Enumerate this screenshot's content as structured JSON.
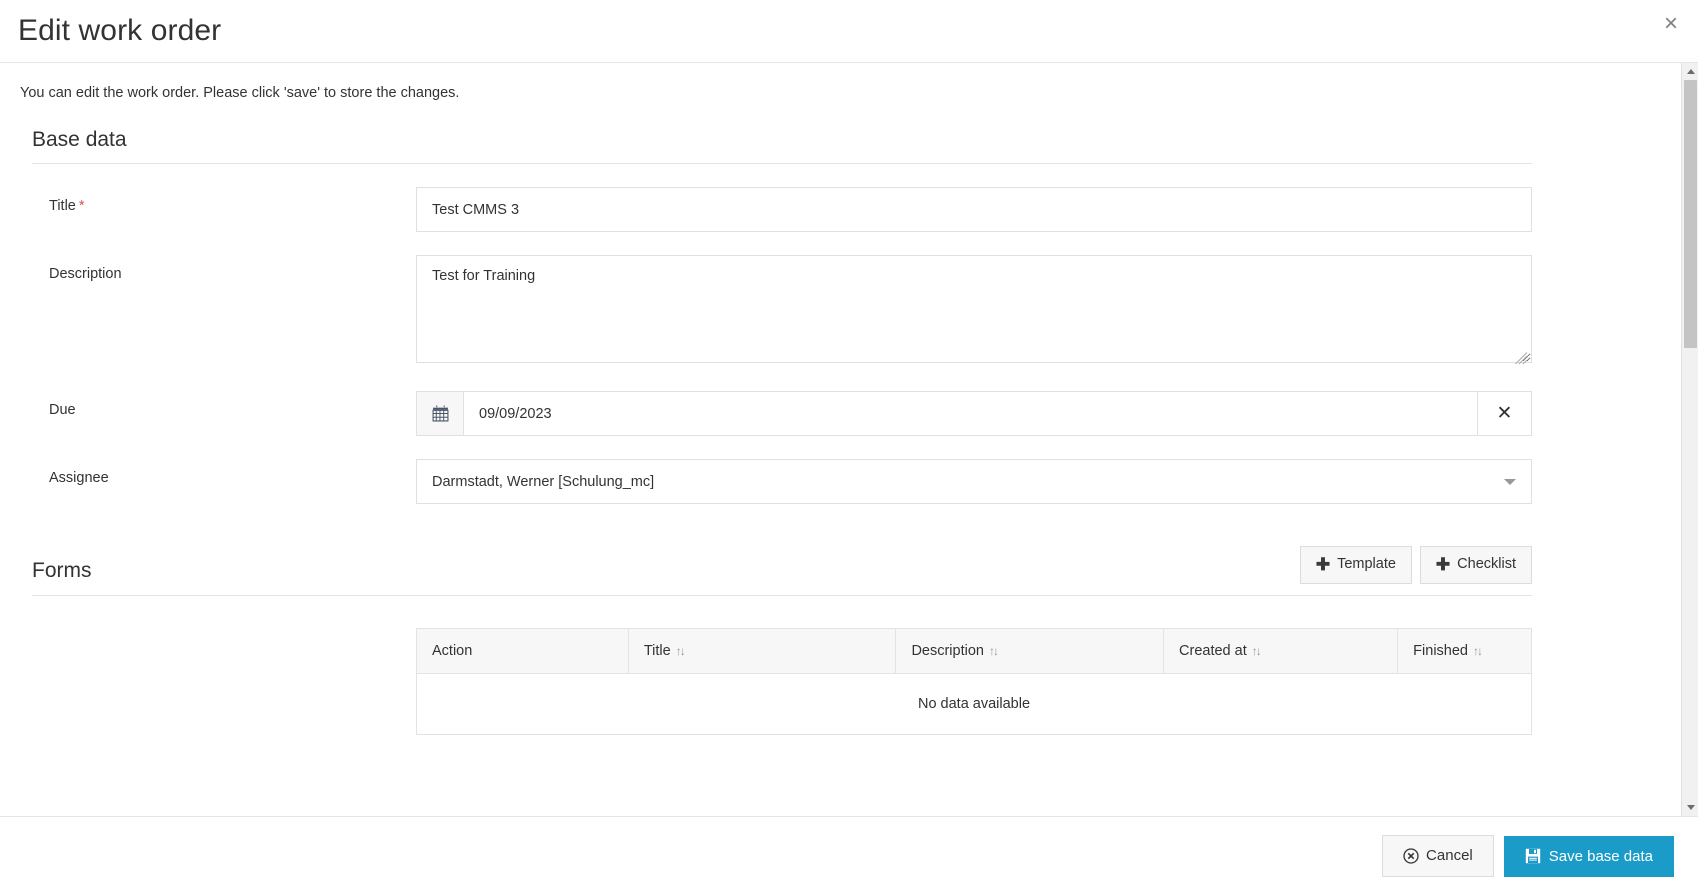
{
  "dialog": {
    "title": "Edit work order",
    "close_label": "×",
    "intro": "You can edit the work order. Please click 'save' to store the changes."
  },
  "base_data": {
    "section_title": "Base data",
    "fields": {
      "title": {
        "label": "Title",
        "required_marker": "*",
        "value": "Test CMMS 3",
        "placeholder": ""
      },
      "description": {
        "label": "Description",
        "value": "Test for Training",
        "placeholder": ""
      },
      "due": {
        "label": "Due",
        "value": "09/09/2023",
        "placeholder": "",
        "calendar_icon": "calendar-icon",
        "clear_label": "✕"
      },
      "assignee": {
        "label": "Assignee",
        "value": "Darmstadt, Werner [Schulung_mc]",
        "caret_icon": "chevron-down-icon"
      }
    }
  },
  "forms": {
    "section_title": "Forms",
    "add_template_label": "Template",
    "add_checklist_label": "Checklist",
    "plus_icon": "plus-icon",
    "table": {
      "columns": [
        {
          "label": "Action",
          "sortable": false
        },
        {
          "label": "Title",
          "sortable": true
        },
        {
          "label": "Description",
          "sortable": true
        },
        {
          "label": "Created at",
          "sortable": true
        },
        {
          "label": "Finished",
          "sortable": true
        }
      ],
      "sort_icon": "↑↓",
      "empty_message": "No data available"
    }
  },
  "footer": {
    "cancel_label": "Cancel",
    "cancel_icon": "circle-x-icon",
    "save_label": "Save base data",
    "save_icon": "floppy-disk-icon"
  },
  "colors": {
    "accent": "#1b9bc8",
    "required": "#d9534f",
    "border": "#e0e0e0"
  }
}
